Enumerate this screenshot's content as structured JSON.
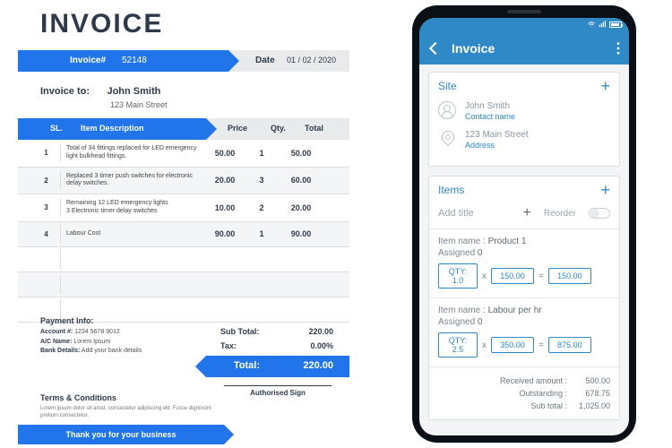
{
  "doc": {
    "title": "INVOICE",
    "invoice_label": "Invoice#",
    "invoice_number": "52148",
    "date_label": "Date",
    "date_value": "01 / 02 / 2020",
    "to_label": "Invoice to:",
    "to_name": "John Smith",
    "to_addr": "123 Main Street",
    "head": {
      "sl": "SL.",
      "desc": "Item Description",
      "price": "Price",
      "qty": "Qty.",
      "total": "Total"
    },
    "rows": [
      {
        "sl": "1",
        "desc": "Total of 34 fittings replaced for LED emergency light bulkhead fittings.",
        "price": "50.00",
        "qty": "1",
        "total": "50.00"
      },
      {
        "sl": "2",
        "desc": "Replaced 3 timer push switches for electronic delay switches.",
        "price": "20.00",
        "qty": "3",
        "total": "60.00"
      },
      {
        "sl": "3",
        "desc": "Remaining 12 LED emergency lights\n3 Electronic timer delay switches",
        "price": "10.00",
        "qty": "2",
        "total": "20.00"
      },
      {
        "sl": "4",
        "desc": "Labour Cost",
        "price": "90.00",
        "qty": "1",
        "total": "90.00"
      }
    ],
    "subtotal_label": "Sub Total:",
    "subtotal": "220.00",
    "tax_label": "Tax:",
    "tax": "0.00%",
    "total_label": "Total:",
    "total": "220.00",
    "pay_title": "Payment Info:",
    "pay_acc_l": "Account #:",
    "pay_acc_v": "1234 5678 9012",
    "pay_ac_l": "A/C Name:",
    "pay_ac_v": "Lorem Ipsum",
    "pay_bank_l": "Bank Details:",
    "pay_bank_v": "Add your bank details",
    "terms_title": "Terms & Conditions",
    "terms_body": "Lorem ipsum dolor sit amet, consectetur adipiscing elit. Fusce dignissim pretium consectetur.",
    "signature": "Authorised Sign",
    "thanks": "Thank you for your business"
  },
  "app": {
    "title": "Invoice",
    "site": {
      "heading": "Site",
      "name": "John Smith",
      "name_lbl": "Contact name",
      "addr": "123 Main Street",
      "addr_lbl": "Address"
    },
    "items": {
      "heading": "Items",
      "add_title_placeholder": "Add title",
      "reorder": "Reorder",
      "list": [
        {
          "name_lbl": "Item name :",
          "name": "Product 1",
          "assigned_lbl": "Assigned",
          "assigned": "0",
          "qty_lbl": "QTY:",
          "qty": "1.0",
          "price": "150.00",
          "total": "150.00"
        },
        {
          "name_lbl": "Item name :",
          "name": "Labour per hr",
          "assigned_lbl": "Assigned",
          "assigned": "0",
          "qty_lbl": "QTY:",
          "qty": "2.5",
          "price": "350.00",
          "total": "875.00"
        }
      ]
    },
    "summary": {
      "received_l": "Received amount :",
      "received_v": "500.00",
      "outstanding_l": "Outstanding :",
      "outstanding_v": "678.75",
      "subtotal_l": "Sub total :",
      "subtotal_v": "1,025.00"
    }
  }
}
